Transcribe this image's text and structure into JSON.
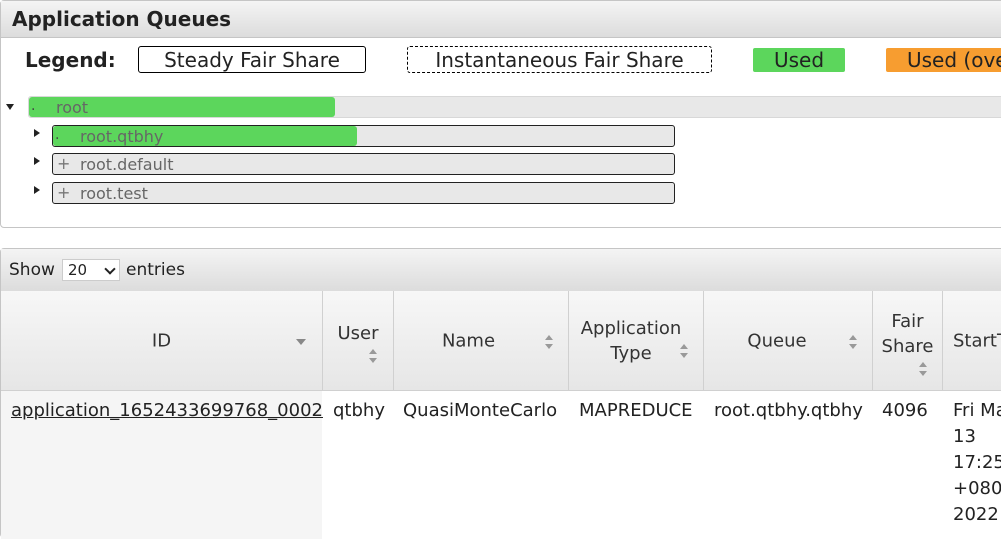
{
  "queues_panel": {
    "title": "Application Queues",
    "legend": {
      "label": "Legend:",
      "steady": "Steady Fair Share",
      "instantaneous": "Instantaneous Fair Share",
      "used": "Used",
      "used_over": "Used (ove"
    },
    "queues": [
      {
        "name": "root",
        "expanded": true,
        "used_fraction": 0.31
      },
      {
        "name": "root.qtbhy",
        "expanded": false,
        "used_fraction": 0.49
      },
      {
        "name": "root.default",
        "expanded": false,
        "used_fraction": 0
      },
      {
        "name": "root.test",
        "expanded": false,
        "used_fraction": 0
      }
    ],
    "dot": ".",
    "plus": "+"
  },
  "apps_panel": {
    "show_label": "Show",
    "entries_label": "entries",
    "entries_value": "20",
    "columns": {
      "id": "ID",
      "user": "User",
      "name": "Name",
      "app_type_line1": "Application",
      "app_type_line2": "Type",
      "queue": "Queue",
      "fair_line1": "Fair",
      "fair_line2": "Share",
      "start": "StartT"
    },
    "row": {
      "id": "application_1652433699768_0002",
      "user": "qtbhy",
      "name": "QuasiMonteCarlo",
      "app_type": "MAPREDUCE",
      "queue": "root.qtbhy.qtbhy",
      "fair_share": "4096",
      "start_l1": "Fri Ma",
      "start_l2": "13",
      "start_l3": "17:25",
      "start_l4": "+080C",
      "start_l5": "2022"
    }
  },
  "colors": {
    "used": "#5cd65c",
    "used_over": "#f79d30"
  }
}
